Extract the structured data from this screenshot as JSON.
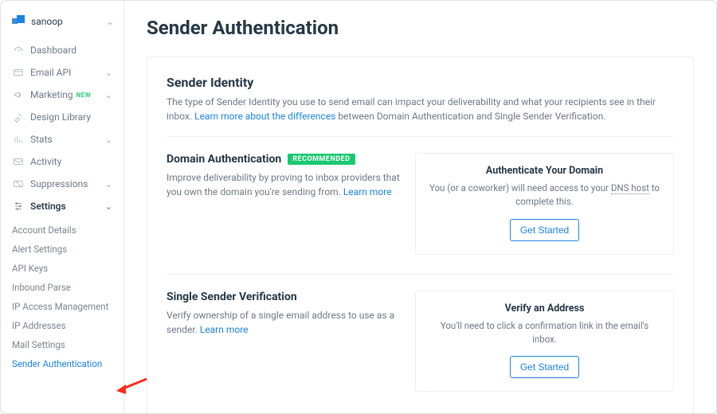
{
  "user": {
    "name": "sanoop"
  },
  "sidebar": {
    "items": [
      {
        "label": "Dashboard"
      },
      {
        "label": "Email API"
      },
      {
        "label": "Marketing",
        "newBadge": "NEW"
      },
      {
        "label": "Design Library"
      },
      {
        "label": "Stats"
      },
      {
        "label": "Activity"
      },
      {
        "label": "Suppressions"
      },
      {
        "label": "Settings"
      }
    ],
    "settingsSub": [
      {
        "label": "Account Details"
      },
      {
        "label": "Alert Settings"
      },
      {
        "label": "API Keys"
      },
      {
        "label": "Inbound Parse"
      },
      {
        "label": "IP Access Management"
      },
      {
        "label": "IP Addresses"
      },
      {
        "label": "Mail Settings"
      },
      {
        "label": "Sender Authentication"
      }
    ]
  },
  "page": {
    "title": "Sender Authentication"
  },
  "identity": {
    "heading": "Sender Identity",
    "descPrefix": "The type of Sender Identity you use to send email can impact your deliverability and what your recipients see in their inbox. ",
    "descLink": "Learn more about the differences",
    "descSuffix": " between Domain Authentication and Single Sender Verification."
  },
  "domainAuth": {
    "title": "Domain Authentication",
    "badge": "RECOMMENDED",
    "descPrefix": "Improve deliverability by proving to inbox providers that you own the domain you're sending from. ",
    "descLink": "Learn more",
    "rightTitle": "Authenticate Your Domain",
    "rightDescPrefix": "You (or a coworker) will need access to your ",
    "rightDescDotted": "DNS host",
    "rightDescSuffix": " to complete this.",
    "cta": "Get Started"
  },
  "singleSender": {
    "title": "Single Sender Verification",
    "descPrefix": "Verify ownership of a single email address to use as a sender. ",
    "descLink": "Learn more",
    "rightTitle": "Verify an Address",
    "rightDesc": "You'll need to click a confirmation link in the email's inbox.",
    "cta": "Get Started"
  }
}
